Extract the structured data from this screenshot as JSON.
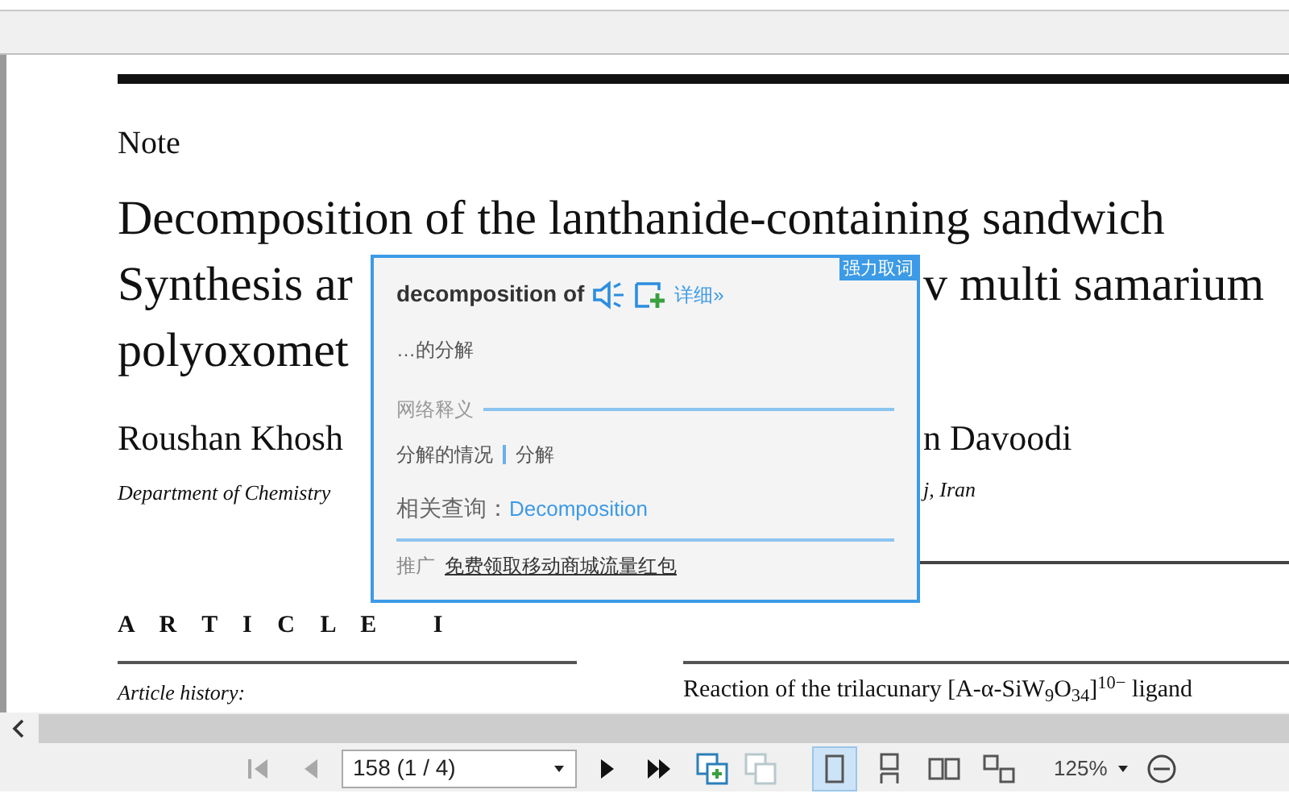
{
  "document": {
    "label": "Note",
    "title_lines": [
      {
        "left": "Decomposition of the lanthanide-containing sandwich"
      },
      {
        "left": "Synthesis ar",
        "right": "v multi samarium"
      },
      {
        "left": "polyoxomet"
      }
    ],
    "authors": {
      "left": "Roushan Khosh",
      "right": "n Davoodi"
    },
    "affiliation": {
      "left": "Department of Chemistry",
      "right": "j, Iran"
    },
    "section_heading": "A R T I C L E   I",
    "history_label": "Article history:",
    "abstract_start": "Reaction of the trilacunary [A-α-SiW$_{9}$O$_{34}$]$^{10−}$ ligand"
  },
  "popup": {
    "badge": "强力取词",
    "word": "decomposition of",
    "details_link": "详细»",
    "meaning": "…的分解",
    "web_section": "网络释义",
    "web_meanings": [
      "分解的情况",
      "分解"
    ],
    "related_label": "相关查询：",
    "related_link": "Decomposition",
    "promo_label": "推广",
    "promo_link": "免费领取移动商城流量红包"
  },
  "toolbar": {
    "nav": [
      {
        "kind": "first",
        "disabled": true
      },
      {
        "kind": "prev",
        "disabled": true
      }
    ],
    "page_field": "158 (1 / 4)",
    "nav_next": [
      {
        "kind": "next",
        "disabled": false
      },
      {
        "kind": "last",
        "disabled": false
      }
    ],
    "tools": [
      {
        "kind": "insert",
        "disabled": false
      },
      {
        "kind": "copy",
        "disabled": true
      }
    ],
    "view_modes": [
      {
        "kind": "single",
        "selected": true
      },
      {
        "kind": "continuous",
        "selected": false
      },
      {
        "kind": "facing",
        "selected": false
      },
      {
        "kind": "cover",
        "selected": false
      }
    ],
    "zoom": "125%"
  }
}
